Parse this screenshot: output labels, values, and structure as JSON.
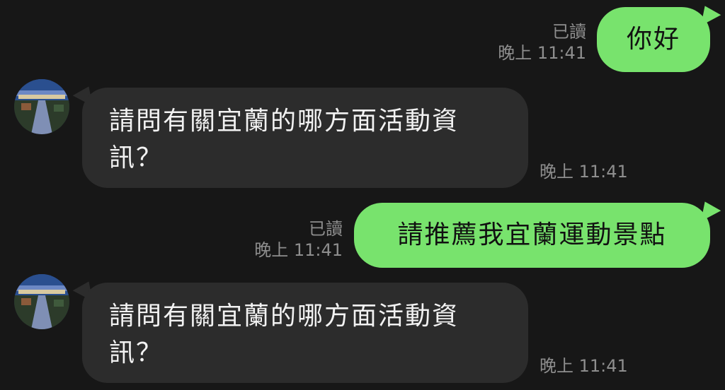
{
  "messages": [
    {
      "direction": "out",
      "text": "你好",
      "read_label": "已讀",
      "time": "晚上 11:41"
    },
    {
      "direction": "in",
      "text": "請問有關宜蘭的哪方面活動資訊？",
      "time": "晚上 11:41"
    },
    {
      "direction": "out",
      "text": "請推薦我宜蘭運動景點",
      "read_label": "已讀",
      "time": "晚上 11:41"
    },
    {
      "direction": "in",
      "text": "請問有關宜蘭的哪方面活動資訊？",
      "time": "晚上 11:41"
    }
  ],
  "colors": {
    "background": "#171717",
    "outgoing_bubble": "#78e36d",
    "incoming_bubble": "#2c2c2c",
    "meta_text": "#8e8e8e"
  },
  "icons": {
    "contact_avatar": "avatar-photo-icon"
  }
}
